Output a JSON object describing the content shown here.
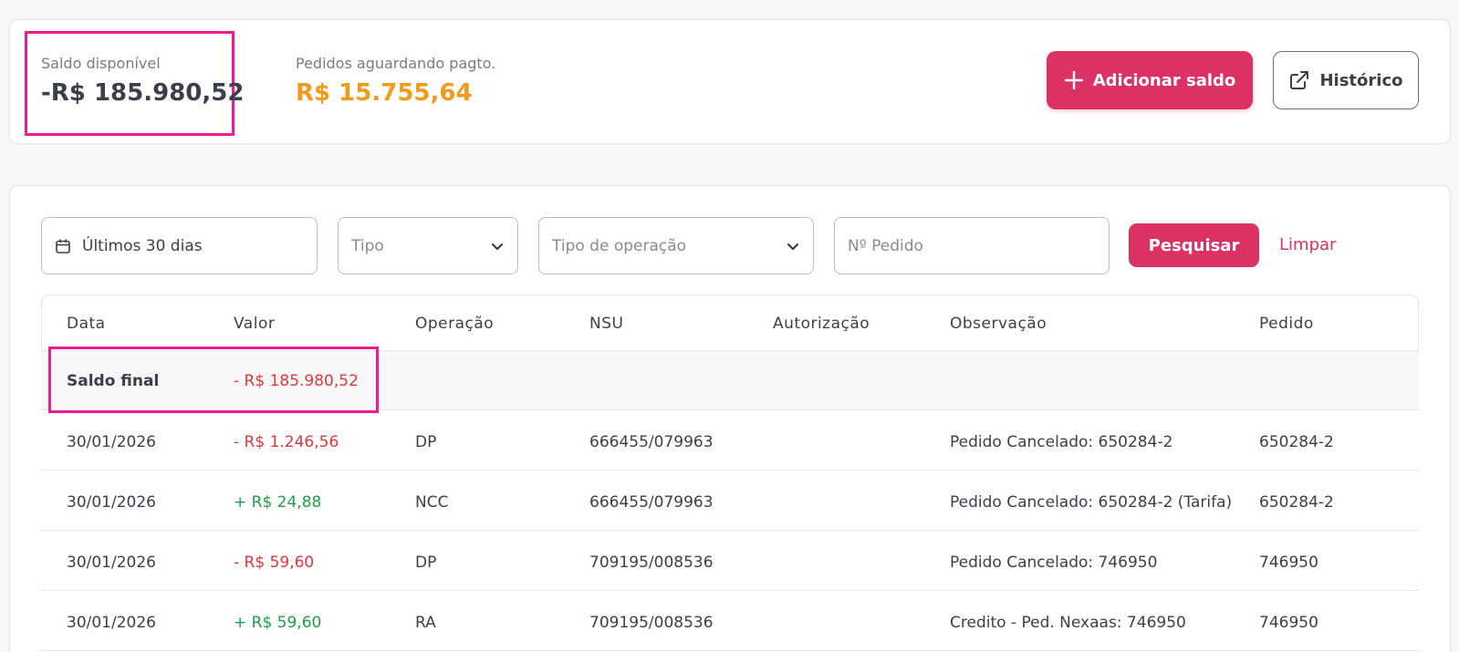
{
  "summary": {
    "balance_label": "Saldo disponível",
    "balance_value": "-R$ 185.980,52",
    "pending_label": "Pedidos aguardando pagto.",
    "pending_value": "R$ 15.755,64"
  },
  "actions": {
    "add_balance_label": "Adicionar saldo",
    "history_label": "Histórico"
  },
  "filters": {
    "date_range": "Últimos 30 dias",
    "type_placeholder": "Tipo",
    "operation_type_placeholder": "Tipo de operação",
    "order_number_placeholder": "Nº Pedido",
    "search_label": "Pesquisar",
    "clear_label": "Limpar"
  },
  "table": {
    "headers": [
      "Data",
      "Valor",
      "Operação",
      "NSU",
      "Autorização",
      "Observação",
      "Pedido"
    ],
    "final_balance": {
      "label": "Saldo final",
      "value": "- R$ 185.980,52"
    },
    "rows": [
      {
        "date": "30/01/2026",
        "value": "- R$ 1.246,56",
        "operation": "DP",
        "nsu": "666455/079963",
        "authorization": "",
        "note": "Pedido Cancelado: 650284-2",
        "order": "650284-2"
      },
      {
        "date": "30/01/2026",
        "value": "+ R$ 24,88",
        "operation": "NCC",
        "nsu": "666455/079963",
        "authorization": "",
        "note": "Pedido Cancelado: 650284-2 (Tarifa)",
        "order": "650284-2"
      },
      {
        "date": "30/01/2026",
        "value": "- R$ 59,60",
        "operation": "DP",
        "nsu": "709195/008536",
        "authorization": "",
        "note": "Pedido Cancelado: 746950",
        "order": "746950"
      },
      {
        "date": "30/01/2026",
        "value": "+ R$ 59,60",
        "operation": "RA",
        "nsu": "709195/008536",
        "authorization": "",
        "note": "Credito - Ped. Nexaas: 746950",
        "order": "746950"
      }
    ]
  },
  "colors": {
    "brand": "#dc3163",
    "pending": "#f29a1b",
    "negative": "#e0383e",
    "positive": "#1f9d47",
    "highlight": "#ee1c8f"
  },
  "icons": {
    "add": "plus-icon",
    "history": "external-link-icon",
    "date": "calendar-icon",
    "dropdown": "chevron-down-icon"
  }
}
